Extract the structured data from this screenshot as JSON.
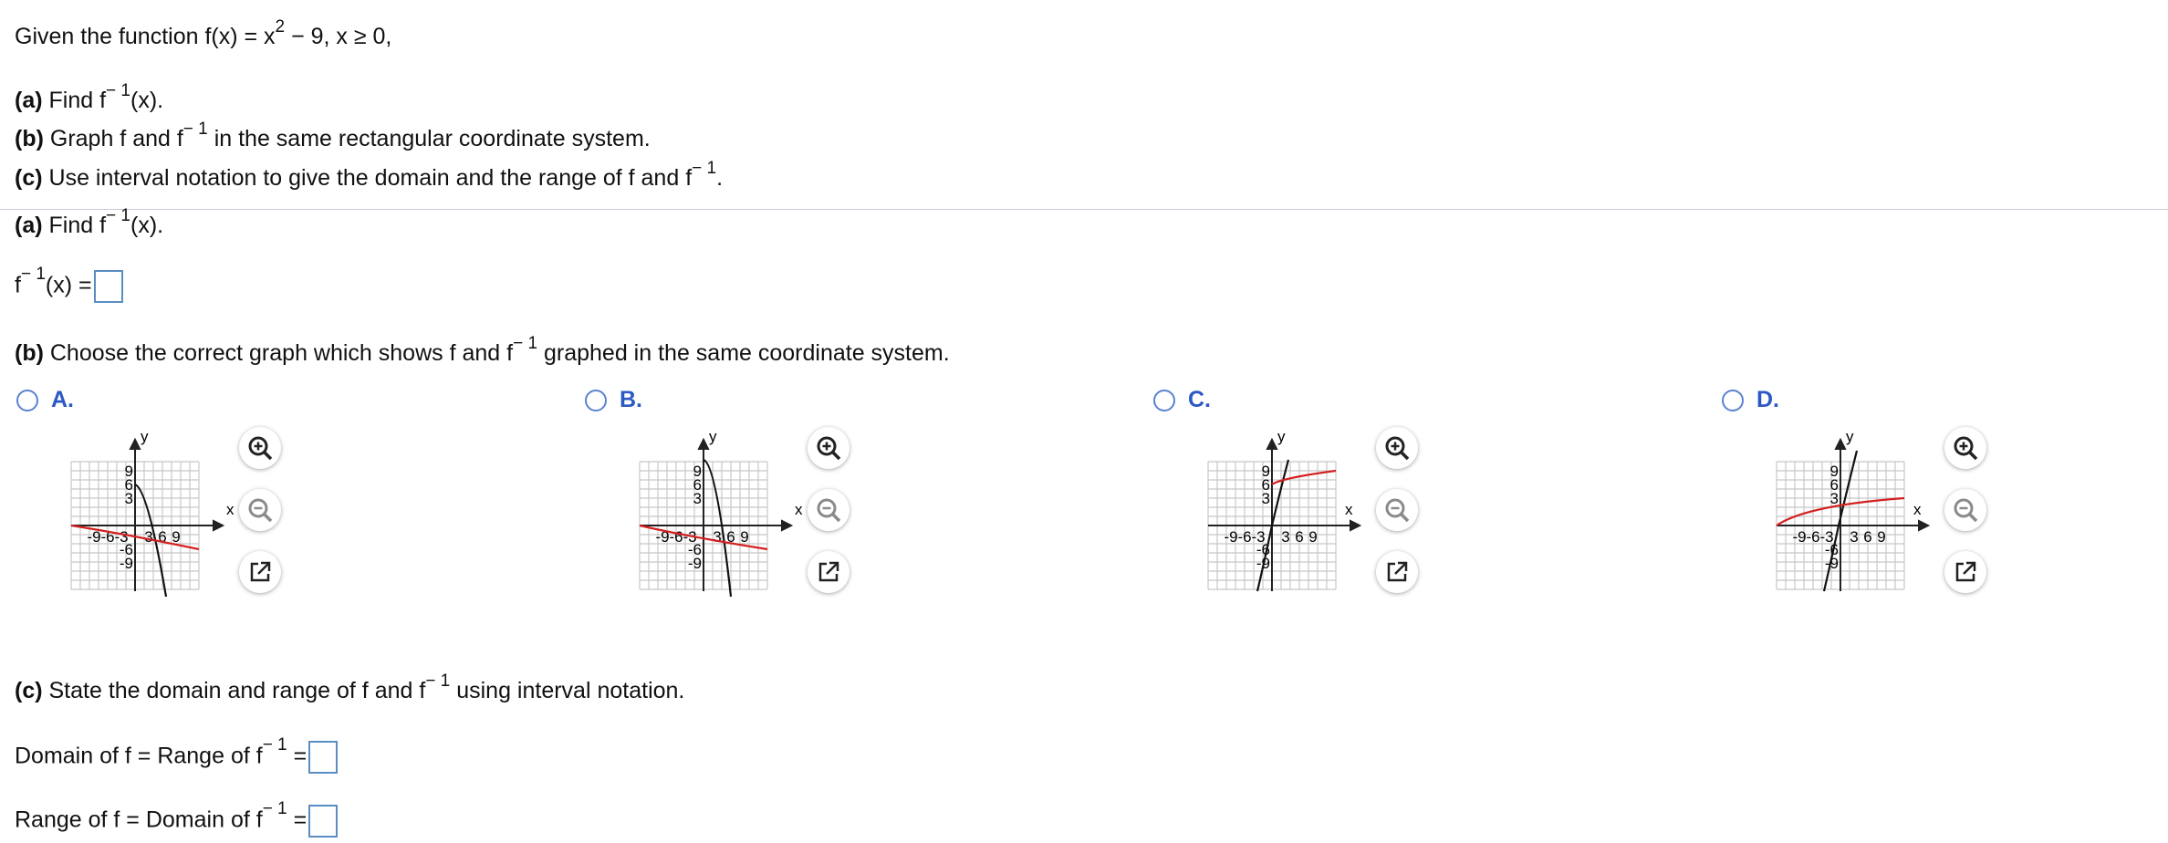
{
  "problem": {
    "intro": {
      "pre": "Given the function f(x) = x",
      "sup": "2",
      "post": " − 9, x ≥ 0,"
    },
    "part_a": {
      "label": "(a)",
      "pre": " Find f",
      "sup": "− 1",
      "post": "(x)."
    },
    "part_b": {
      "label": "(b)",
      "pre": " Graph f and f",
      "sup": "− 1",
      "post": " in the same rectangular coordinate system."
    },
    "part_c": {
      "label": "(c)",
      "pre": " Use interval notation to give the domain and the range of f and f",
      "sup": "− 1",
      "post": "."
    }
  },
  "section_a": {
    "heading": {
      "label": "(a)",
      "pre": " Find f",
      "sup": "− 1",
      "post": "(x)."
    },
    "answer": {
      "pre": "f",
      "sup": "− 1",
      "post": "(x) ="
    }
  },
  "section_b": {
    "heading": {
      "label": "(b)",
      "pre": " Choose the correct graph which shows f and f",
      "sup": "− 1",
      "post": " graphed in the same coordinate system."
    },
    "options": [
      {
        "letter": "A."
      },
      {
        "letter": "B."
      },
      {
        "letter": "C."
      },
      {
        "letter": "D."
      }
    ],
    "graph_labels": {
      "x": "x",
      "y": "y",
      "pos_ticks": [
        "3",
        "6",
        "9"
      ],
      "neg_ticks": [
        "-9",
        "-6",
        "-3"
      ],
      "neg_y_ticks": [
        "-6",
        "-9"
      ]
    },
    "colors": {
      "f_curve": "#111111",
      "inverse_curve": "#d42020",
      "grid": "#c8c8c8"
    }
  },
  "section_c": {
    "heading": {
      "label": "(c)",
      "pre": " State the domain and range of f and f",
      "sup": "− 1",
      "post": " using interval notation."
    },
    "domain_row": {
      "pre": "Domain of f = Range of f",
      "sup": "− 1",
      "post": " ="
    },
    "range_row": {
      "pre": "Range of f = Domain of f",
      "sup": "− 1",
      "post": " ="
    }
  }
}
